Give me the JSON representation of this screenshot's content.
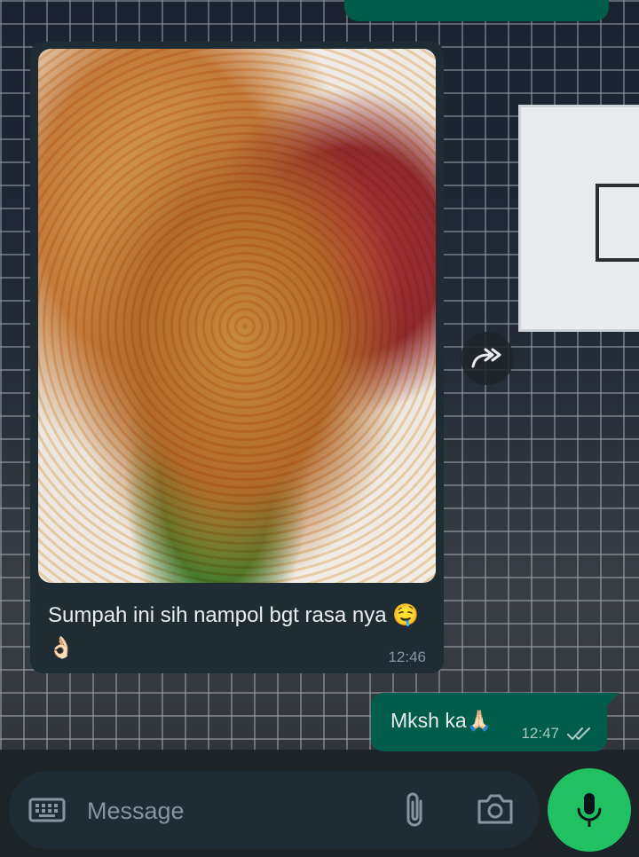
{
  "chat": {
    "incoming": {
      "caption": "Sumpah ini sih nampol bgt rasa nya ",
      "emoji_1": "🤤",
      "emoji_2": "👌🏻",
      "time": "12:46"
    },
    "outgoing": {
      "text": "Mksh ka",
      "emoji": "🙏🏻",
      "time": "12:47",
      "status_icon": "double-check-icon"
    }
  },
  "composer": {
    "placeholder": "Message",
    "keyboard_icon": "keyboard-icon",
    "attach_icon": "paperclip-icon",
    "camera_icon": "camera-icon",
    "mic_icon": "microphone-icon"
  },
  "colors": {
    "outgoing_bubble": "#005c4b",
    "incoming_bubble": "#1f2c34",
    "mic_button": "#21c063",
    "meta_text": "#8696a0"
  }
}
